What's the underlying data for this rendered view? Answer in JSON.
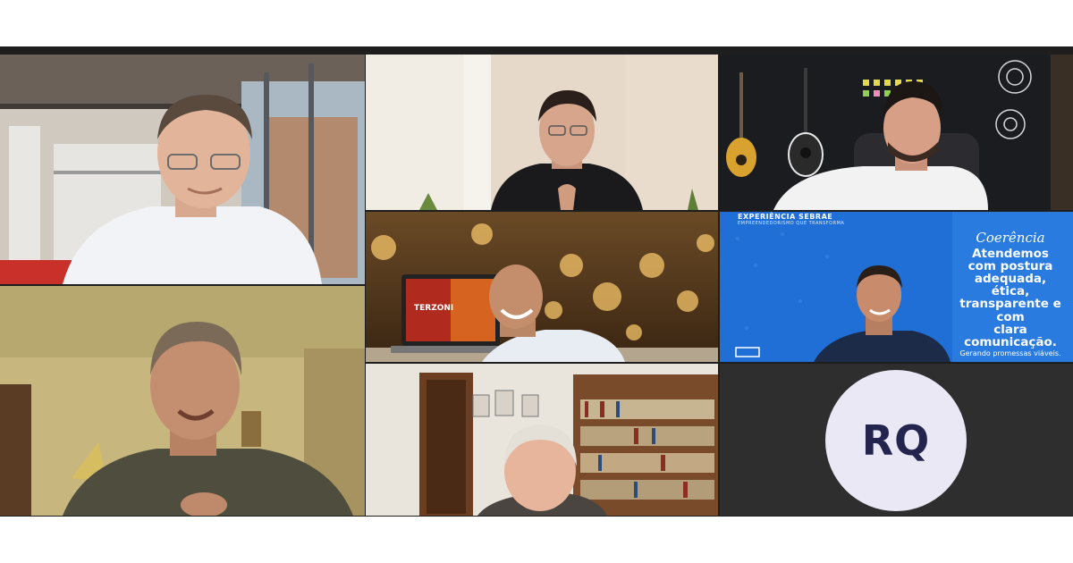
{
  "participants": [
    {
      "position": 1,
      "video": true
    },
    {
      "position": 2,
      "video": true
    },
    {
      "position": 3,
      "video": true
    },
    {
      "position": 4,
      "video": true
    },
    {
      "position": 5,
      "video": true,
      "laptop_logo": "TERZONI"
    },
    {
      "position": 6,
      "video": true,
      "background_brand": "EXPERIÊNCIA SEBRAE",
      "background_brand_sub": "EMPREENDEDORISMO QUE TRANSFORMA",
      "banner_title": "Coerência",
      "banner_main": "Atendemos\ncom postura\nadequada, ética,\ntransparente e com\nclara comunicação.",
      "banner_small": "Gerando promessas viáveis."
    },
    {
      "position": 7,
      "video": true
    },
    {
      "position": 8,
      "video": false,
      "initials": "RQ",
      "avatar_color": "#ebe8f6",
      "initials_color": "#23254f"
    }
  ],
  "colors": {
    "grid_background": "#1e1e1e",
    "page_background": "#ffffff",
    "sebrae_blue": "#1f6fd6"
  }
}
